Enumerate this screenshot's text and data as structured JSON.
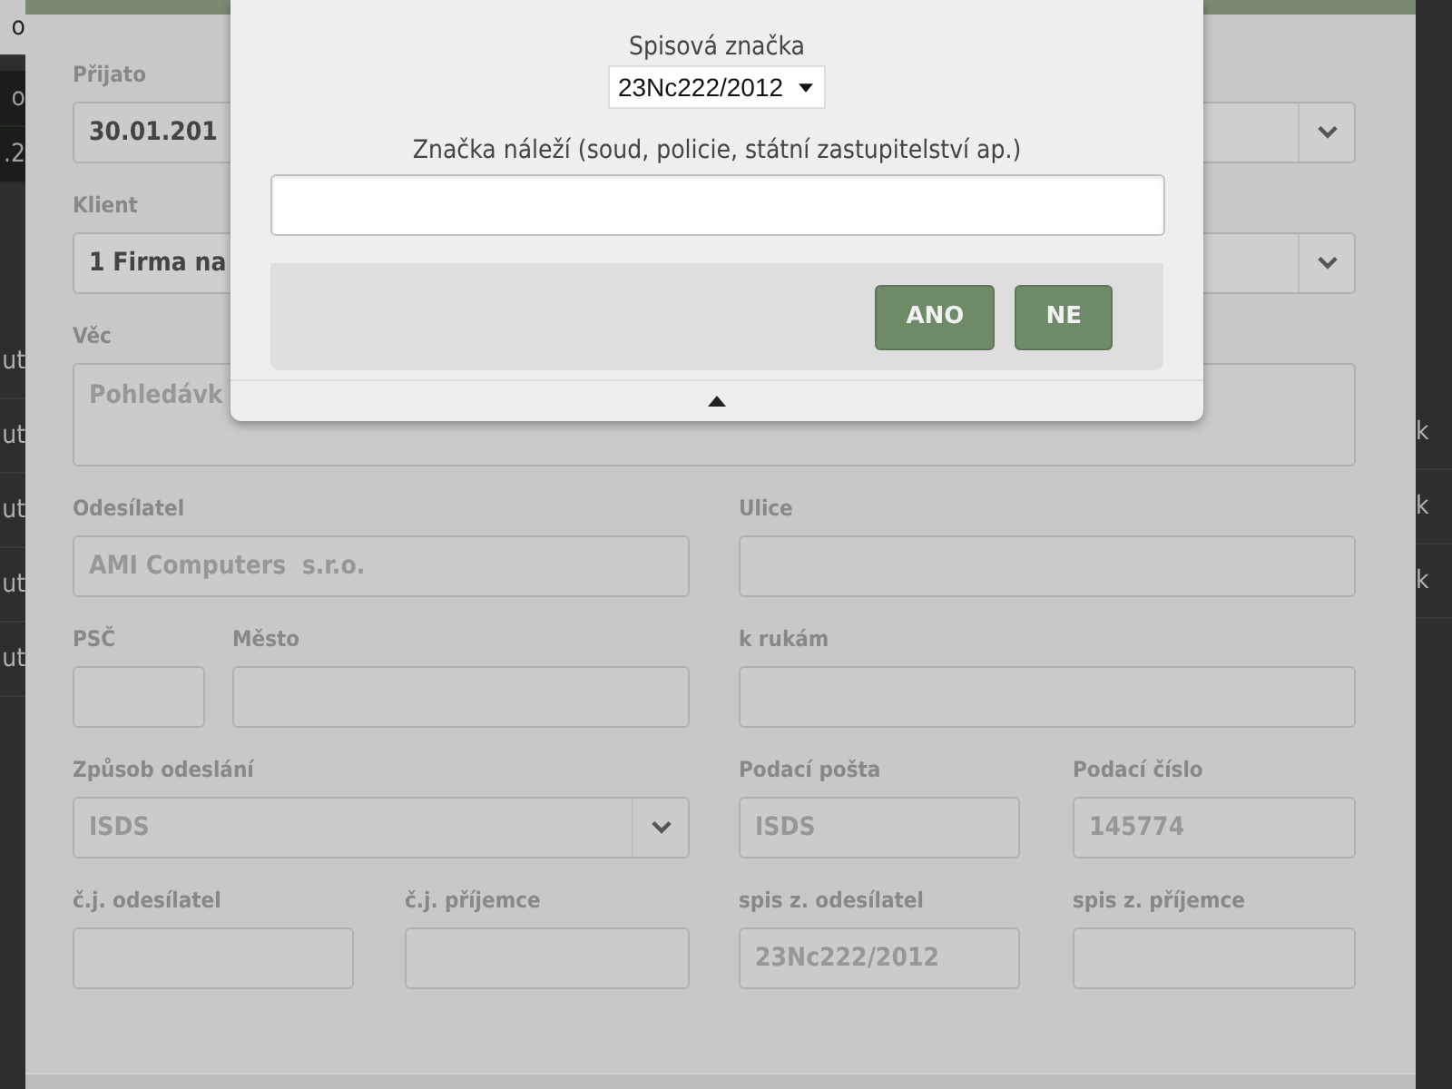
{
  "background": {
    "left": [
      {
        "text": "o",
        "kind": "head"
      },
      {
        "text": "o",
        "kind": "dark"
      },
      {
        "text": ".2",
        "kind": "dark"
      },
      {
        "text": "ut",
        "kind": "row"
      },
      {
        "text": "ut",
        "kind": "row"
      },
      {
        "text": "ut",
        "kind": "row"
      },
      {
        "text": "ut",
        "kind": "row"
      },
      {
        "text": "ut",
        "kind": "row"
      }
    ],
    "right": [
      {
        "text": "k",
        "kind": "row"
      },
      {
        "text": "k",
        "kind": "row"
      },
      {
        "text": "k",
        "kind": "row"
      }
    ]
  },
  "form": {
    "fields": [
      {
        "label": "Přijato",
        "kind": "text",
        "value": "30.01.201"
      },
      {
        "kind": "select"
      },
      {
        "label": "Klient",
        "kind": "select",
        "value": "1 Firma na"
      },
      {
        "label": "Věc",
        "kind": "textarea",
        "value": "Pohledávk"
      },
      {
        "label": "Odesílatel",
        "kind": "text",
        "value": "AMI Computers  s.r.o."
      },
      {
        "label": "Ulice",
        "kind": "text"
      },
      {
        "label": "PSČ",
        "kind": "text"
      },
      {
        "label": "Město",
        "kind": "text"
      },
      {
        "label": "k rukám",
        "kind": "text"
      },
      {
        "label": "Způsob odeslání",
        "kind": "select",
        "value": "ISDS"
      },
      {
        "label": "Podací pošta",
        "kind": "text",
        "value": "ISDS"
      },
      {
        "label": "Podací číslo",
        "kind": "text",
        "value": "145774"
      },
      {
        "label": "č.j. odesílatel",
        "kind": "text"
      },
      {
        "label": "č.j. příjemce",
        "kind": "text"
      },
      {
        "label": "spis z. odesílatel",
        "kind": "text",
        "value": "23Nc222/2012"
      },
      {
        "label": "spis z. příjemce",
        "kind": "text"
      }
    ]
  },
  "dialog": {
    "file_mark": {
      "label": "Spisová značka",
      "value": "23Nc222/2012"
    },
    "authority": {
      "label": "Značka náleží (soud, policie, státní zastupitelství ap.)"
    },
    "buttons": [
      "ANO",
      "NE"
    ]
  }
}
